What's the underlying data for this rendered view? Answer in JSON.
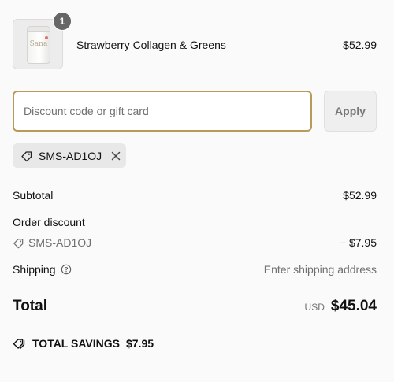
{
  "line_item": {
    "quantity": "1",
    "name": "Strawberry Collagen & Greens",
    "price": "$52.99",
    "image_label": "Sana",
    "image_icon": "product-jar-image"
  },
  "discount": {
    "placeholder": "Discount code or gift card",
    "value": "",
    "apply_label": "Apply",
    "applied_code": "SMS-AD1OJ",
    "tag_icon": "tag-icon",
    "remove_icon": "close-icon",
    "accent_color": "#b89a5a"
  },
  "summary": {
    "subtotal_label": "Subtotal",
    "subtotal_value": "$52.99",
    "order_discount_label": "Order discount",
    "discount_code": "SMS-AD1OJ",
    "discount_value": "− $7.95",
    "shipping_label": "Shipping",
    "shipping_help_icon": "help-circle-icon",
    "shipping_value": "Enter shipping address"
  },
  "total": {
    "label": "Total",
    "currency": "USD",
    "amount": "$45.04"
  },
  "savings": {
    "icon": "tags-icon",
    "label": "TOTAL SAVINGS",
    "amount": "$7.95"
  }
}
